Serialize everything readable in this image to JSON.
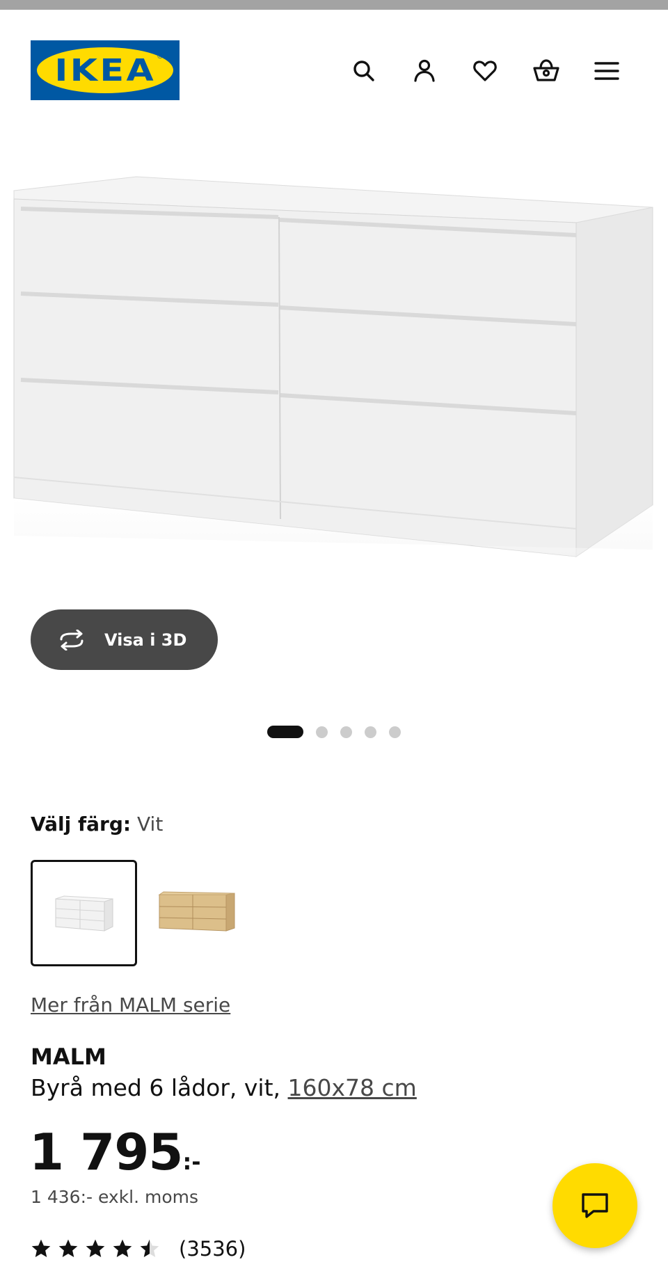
{
  "header": {
    "logo_text": "IKEA",
    "logo_registered": "®",
    "icons": [
      "search-icon",
      "account-icon",
      "heart-icon",
      "basket-icon",
      "menu-icon"
    ]
  },
  "hero": {
    "view3d_label": "Visa i 3D",
    "carousel_count": 5,
    "carousel_active": 0
  },
  "color": {
    "label": "Välj färg:",
    "value": "Vit",
    "options": [
      "white",
      "oak"
    ]
  },
  "series_link": "Mer från MALM serie",
  "product": {
    "name": "MALM",
    "description": "Byrå med 6 lådor, vit,",
    "size": "160x78 cm"
  },
  "price": {
    "main": "1 795",
    "suffix": ":-",
    "excl_vat": "1 436:- exkl. moms"
  },
  "rating": {
    "stars": 4.5,
    "count": "(3536)"
  },
  "colors": {
    "ikea_blue": "#0058a3",
    "ikea_yellow": "#ffdb00",
    "dark_button": "#484848"
  }
}
